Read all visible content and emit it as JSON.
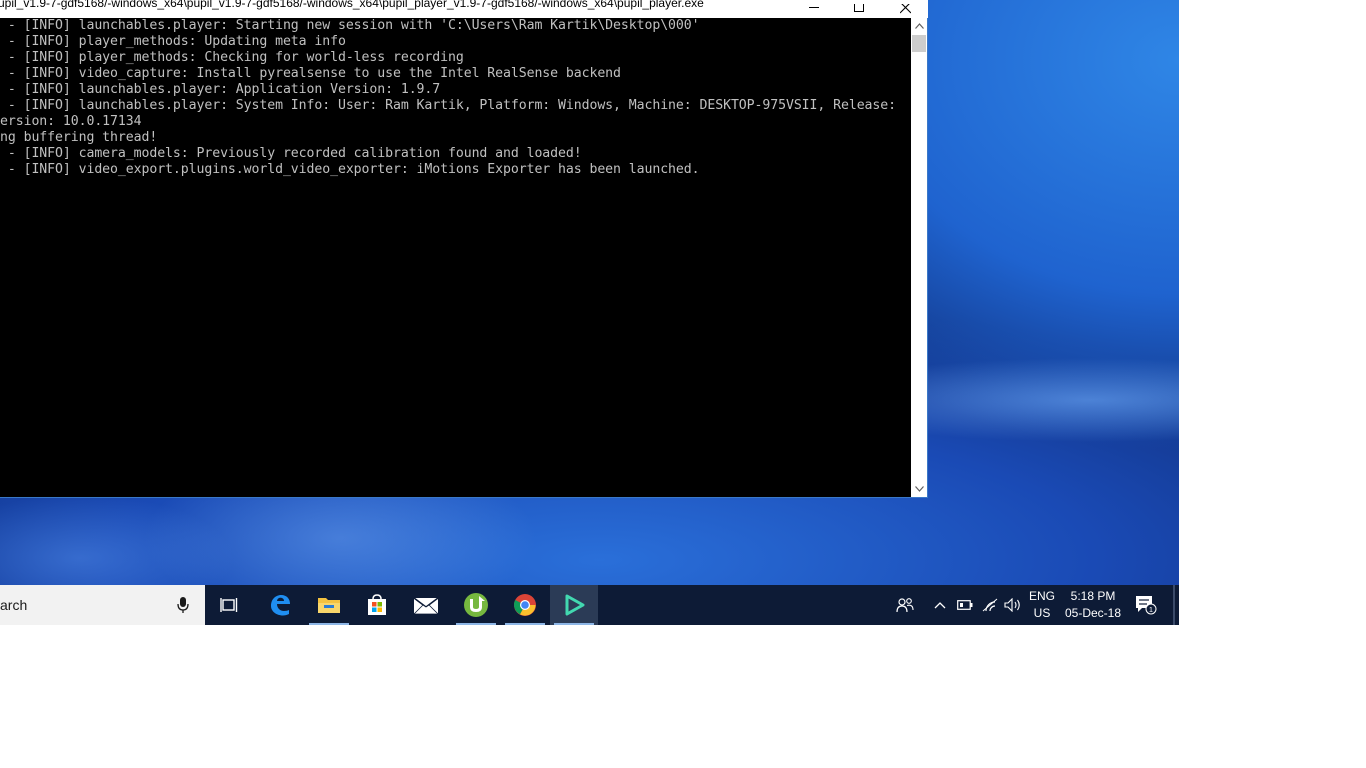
{
  "console": {
    "title": "upil_v1.9-7-gdf5168/-windows_x64\\pupil_v1.9-7-gdf5168/-windows_x64\\pupil_player_v1.9-7-gdf5168/-windows_x64\\pupil_player.exe",
    "lines": [
      " - [INFO] launchables.player: Starting new session with 'C:\\Users\\Ram Kartik\\Desktop\\000'",
      " - [INFO] player_methods: Updating meta info",
      " - [INFO] player_methods: Checking for world-less recording",
      " - [INFO] video_capture: Install pyrealsense to use the Intel RealSense backend",
      " - [INFO] launchables.player: Application Version: 1.9.7",
      " - [INFO] launchables.player: System Info: User: Ram Kartik, Platform: Windows, Machine: DESKTOP-975VSII, Release:",
      "ersion: 10.0.17134",
      "ng buffering thread!",
      " - [INFO] camera_models: Previously recorded calibration found and loaded!",
      " - [INFO] video_export.plugins.world_video_exporter: iMotions Exporter has been launched."
    ]
  },
  "taskbar": {
    "search_text": "arch",
    "apps": [
      {
        "name": "task-view",
        "icon": "task-view-icon"
      },
      {
        "name": "edge",
        "icon": "edge-icon"
      },
      {
        "name": "file-explorer",
        "icon": "folder-icon"
      },
      {
        "name": "microsoft-store",
        "icon": "store-icon"
      },
      {
        "name": "mail",
        "icon": "mail-icon"
      },
      {
        "name": "utorrent",
        "icon": "utorrent-icon"
      },
      {
        "name": "chrome",
        "icon": "chrome-icon"
      },
      {
        "name": "pupil-player",
        "icon": "pupil-player-icon"
      }
    ],
    "tray": {
      "language": "ENG",
      "region": "US",
      "time": "5:18 PM",
      "date": "05-Dec-18",
      "notification_count": "1"
    }
  },
  "colors": {
    "console_text": "#c0c0c0",
    "console_bg": "#000000",
    "taskbar_bg": "#0d1b36",
    "active_underline": "#8db6e6"
  }
}
